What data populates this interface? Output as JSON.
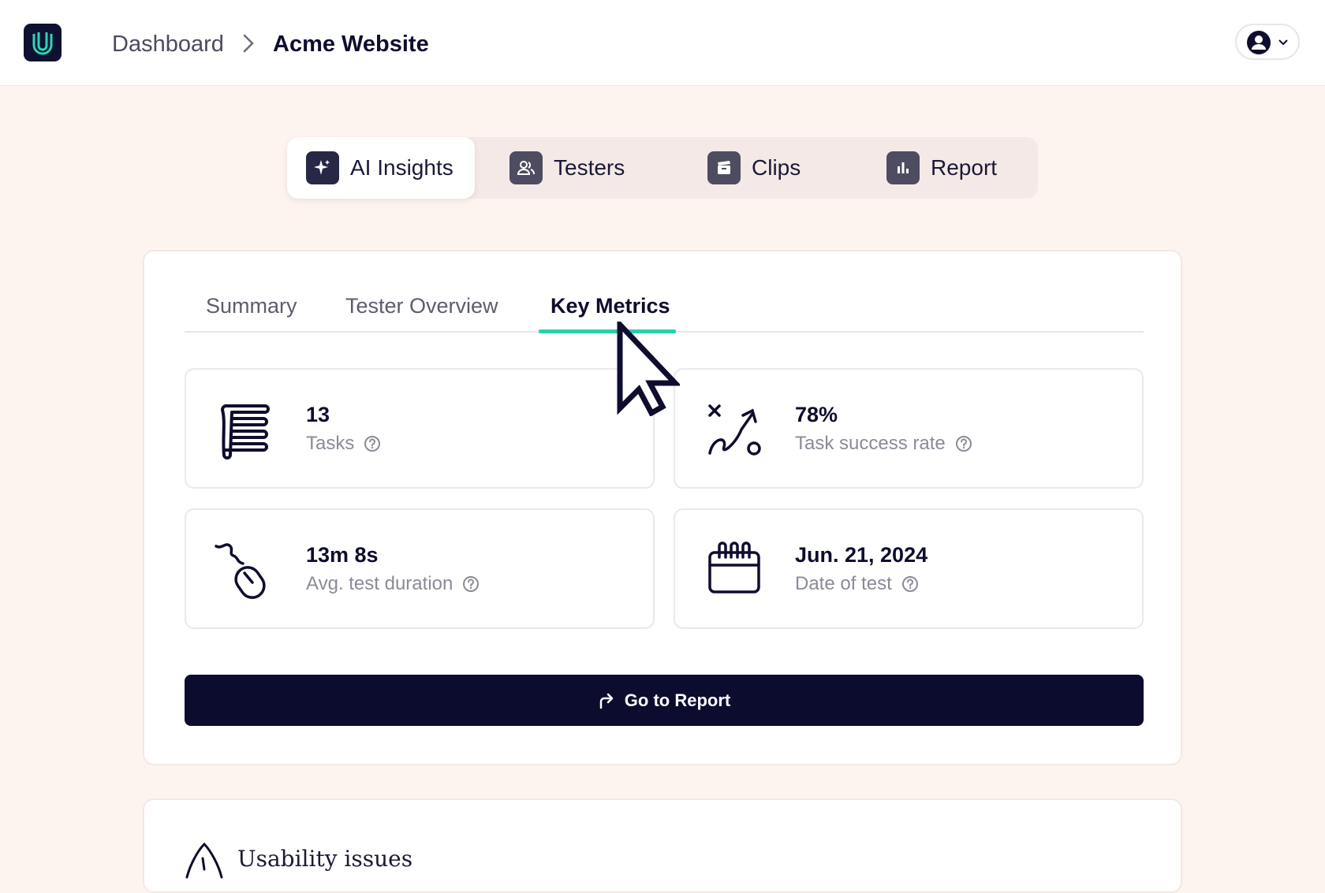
{
  "header": {
    "breadcrumb_parent": "Dashboard",
    "breadcrumb_current": "Acme Website"
  },
  "nav": {
    "segments": [
      {
        "label": "AI Insights",
        "icon": "sparkle-icon",
        "active": true
      },
      {
        "label": "Testers",
        "icon": "users-icon",
        "active": false
      },
      {
        "label": "Clips",
        "icon": "clapperboard-icon",
        "active": false
      },
      {
        "label": "Report",
        "icon": "bar-chart-icon",
        "active": false
      }
    ]
  },
  "tabs": [
    {
      "label": "Summary",
      "active": false
    },
    {
      "label": "Tester Overview",
      "active": false
    },
    {
      "label": "Key Metrics",
      "active": true
    }
  ],
  "metrics": [
    {
      "value": "13",
      "label": "Tasks",
      "icon": "checklist-scroll-icon"
    },
    {
      "value": "78%",
      "label": "Task success rate",
      "icon": "success-path-icon"
    },
    {
      "value": "13m 8s",
      "label": "Avg. test duration",
      "icon": "mouse-icon"
    },
    {
      "value": "Jun. 21, 2024",
      "label": "Date of test",
      "icon": "calendar-icon"
    }
  ],
  "cta": {
    "label": "Go to Report",
    "icon": "share-arrow-icon"
  },
  "issues": {
    "title": "Usability issues",
    "icon": "warning-icon"
  },
  "colors": {
    "background": "#fdf3ef",
    "navy": "#0c0c2e",
    "accent_teal": "#29d1b0",
    "muted_text": "#8c8a98"
  }
}
